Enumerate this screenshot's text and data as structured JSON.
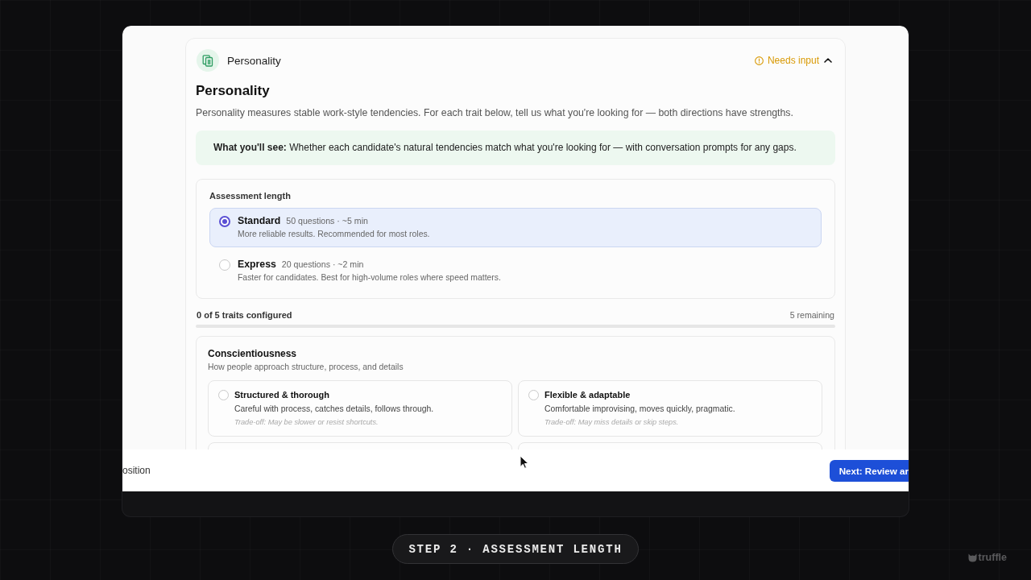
{
  "section": {
    "title": "Personality",
    "status": {
      "label": "Needs input",
      "kind": "warning"
    },
    "expanded": true
  },
  "heading": "Personality",
  "description": "Personality measures stable work-style tendencies. For each trait below, tell us what you're looking for — both directions have strengths.",
  "callout": "**What you'll see:** Whether each candidate's natural tendencies match what you're looking for — with conversation prompts for any gaps.",
  "assessment_length": {
    "label": "Assessment length",
    "options": [
      {
        "name": "Standard",
        "meta": "50 questions · ~5 min",
        "description": "More reliable results. Recommended for most roles.",
        "selected": true
      },
      {
        "name": "Express",
        "meta": "20 questions · ~2 min",
        "description": "Faster for candidates. Best for high-volume roles where speed matters.",
        "selected": false
      }
    ]
  },
  "progress": {
    "label": "0 of 5 traits configured",
    "remaining": "5 remaining"
  },
  "traits": [
    {
      "name": "Conscientiousness",
      "description": "How people approach structure, process, and details",
      "options": [
        {
          "title": "Structured & thorough",
          "description": "Careful with process, catches details, follows through.",
          "trade_off": "Trade-off: May be slower or resist shortcuts.",
          "selected": false
        },
        {
          "title": "Flexible & adaptable",
          "description": "Comfortable improvising, moves quickly, pragmatic.",
          "trade_off": "Trade-off: May miss details or skip steps.",
          "selected": false
        }
      ]
    }
  ],
  "footer": {
    "back_link": "osition",
    "next_button": "Next: Review ar"
  },
  "step_label": "STEP 2 · ASSESSMENT LENGTH",
  "brand": "truffle"
}
